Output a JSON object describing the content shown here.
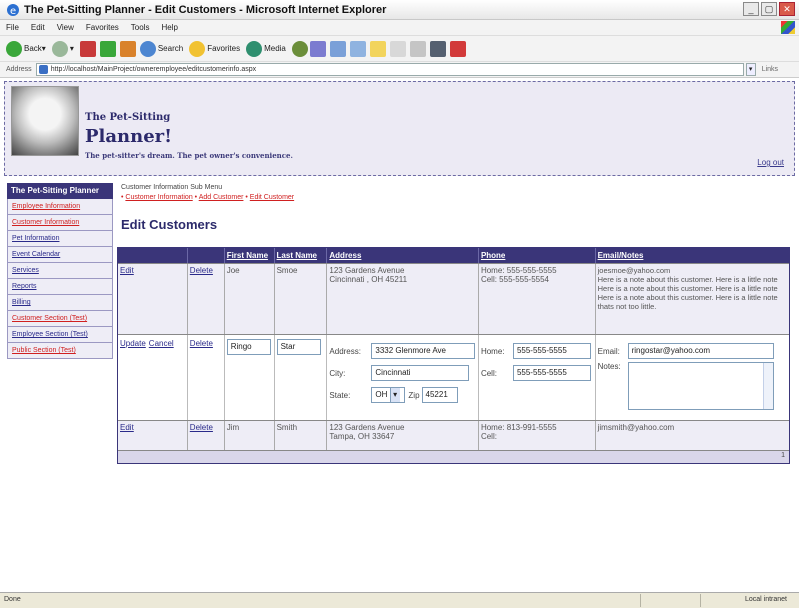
{
  "window": {
    "title": "The Pet-Sitting Planner - Edit Customers - Microsoft Internet Explorer",
    "buttons": [
      "_",
      "▢",
      "✕"
    ]
  },
  "menu": [
    "File",
    "Edit",
    "View",
    "Favorites",
    "Tools",
    "Help"
  ],
  "toolbar": {
    "back": "Back",
    "search": "Search",
    "favorites": "Favorites",
    "media": "Media"
  },
  "address": {
    "label": "Address",
    "url": "http://localhost/MainProject/owneremployee/editcustomerinfo.aspx",
    "links": "Links"
  },
  "header": {
    "brand_line1": "The Pet-Sitting",
    "brand_line2": "Planner!",
    "tagline": "The pet-sitter's dream. The pet owner's convenience.",
    "logout": "Log out"
  },
  "sidebar": {
    "title": "The Pet-Sitting Planner",
    "items": [
      {
        "label": "Employee Information",
        "style": "red"
      },
      {
        "label": "Customer Information",
        "style": "red"
      },
      {
        "label": "Pet Information",
        "style": "blue"
      },
      {
        "label": "Event Calendar",
        "style": "blue"
      },
      {
        "label": "Services",
        "style": "blue"
      },
      {
        "label": "Reports",
        "style": "blue"
      },
      {
        "label": "Billing",
        "style": "blue"
      },
      {
        "label": "Customer Section (Test)",
        "style": "red"
      },
      {
        "label": "Employee Section (Test)",
        "style": "blue"
      },
      {
        "label": "Public Section (Test)",
        "style": "red"
      }
    ]
  },
  "submenu": {
    "title": "Customer Information Sub Menu",
    "links": [
      "Customer Information",
      "Add Customer",
      "Edit Customer"
    ]
  },
  "page_title": "Edit Customers",
  "grid": {
    "headers": [
      "",
      "",
      "First Name",
      "Last Name",
      "Address",
      "Phone",
      "Email/Notes"
    ],
    "rows": [
      {
        "edit": "Edit",
        "delete": "Delete",
        "first": "Joe",
        "last": "Smoe",
        "address": "123 Gardens Avenue\nCincinnati , OH 45211",
        "phone": "Home: 555-555-5555\nCell: 555-555-5554",
        "email_notes": "joesmoe@yahoo.com\nHere is a note about this customer. Here is a little note Here is a note about this customer. Here is a little note Here is a note about this customer. Here is a little note thats not too little."
      },
      {
        "edit": "Edit",
        "delete": "Delete",
        "first": "Jim",
        "last": "Smith",
        "address": "123 Gardens Avenue\nTampa, OH 33647",
        "phone": "Home: 813-991-5555\nCell:",
        "email_notes": "jimsmith@yahoo.com"
      }
    ],
    "edit_row": {
      "update": "Update",
      "cancel": "Cancel",
      "delete": "Delete",
      "first": "Ringo",
      "last": "Star",
      "address_label": "Address:",
      "address": "3332 Glenmore Ave",
      "city_label": "City:",
      "city": "Cincinnati",
      "state_label": "State:",
      "state": "OH",
      "zip_label": "Zip",
      "zip": "45221",
      "home_label": "Home:",
      "home": "555-555-5555",
      "cell_label": "Cell:",
      "cell": "555-555-5555",
      "email_label": "Email:",
      "email": "ringostar@yahoo.com",
      "notes_label": "Notes:",
      "notes": ""
    },
    "pager": "1"
  },
  "status": {
    "text": "Done",
    "zone": "Local intranet"
  }
}
